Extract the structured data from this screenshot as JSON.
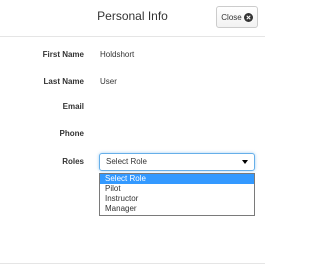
{
  "header": {
    "title": "Personal Info",
    "close_label": "Close"
  },
  "fields": {
    "first_name": {
      "label": "First Name",
      "value": "Holdshort"
    },
    "last_name": {
      "label": "Last Name",
      "value": "User"
    },
    "email": {
      "label": "Email",
      "value": ""
    },
    "phone": {
      "label": "Phone",
      "value": ""
    },
    "roles": {
      "label": "Roles",
      "selected": "Select Role",
      "options": [
        "Select Role",
        "Pilot",
        "Instructor",
        "Manager"
      ],
      "highlighted_index": 0
    }
  },
  "colors": {
    "highlight": "#3399ff",
    "focus_border": "#66afe9"
  }
}
